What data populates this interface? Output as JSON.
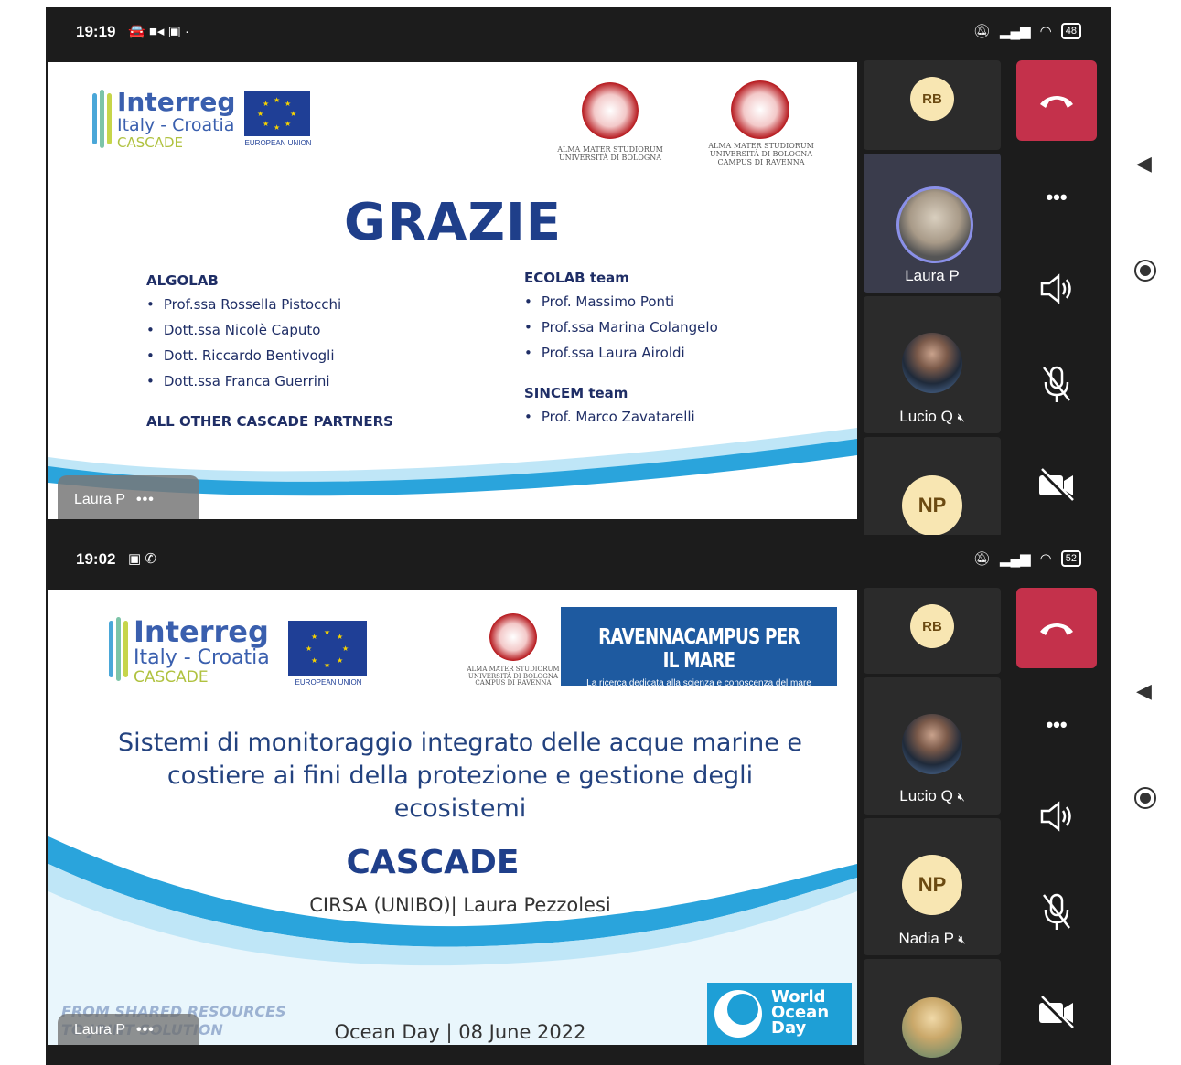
{
  "screens": [
    {
      "status_time": "19:19",
      "status_left_icons": "🚘 ■◂ ▣ ·",
      "battery": "48",
      "slide": {
        "program_name": "Interreg",
        "program_region": "Italy - Croatia",
        "program_project": "CASCADE",
        "eu_caption": "EUROPEAN UNION",
        "seal1_text": "ALMA MATER STUDIORUM\nUNIVERSITÀ DI BOLOGNA",
        "seal2_text": "ALMA MATER STUDIORUM\nUNIVERSITÀ DI BOLOGNA\nCAMPUS DI RAVENNA",
        "title": "GRAZIE",
        "left_col": {
          "heading": "ALGOLAB",
          "items": [
            "Prof.ssa Rossella Pistocchi",
            "Dott.ssa Nicolè Caputo",
            "Dott. Riccardo Bentivogli",
            "Dott.ssa Franca Guerrini"
          ],
          "footer": "ALL OTHER CASCADE PARTNERS"
        },
        "right_col": {
          "heading": "ECOLAB team",
          "items": [
            "Prof. Massimo Ponti",
            "Prof.ssa Marina Colangelo",
            "Prof.ssa Laura Airoldi"
          ],
          "heading2": "SINCEM team",
          "items2": [
            "Prof. Marco Zavatarelli"
          ]
        }
      },
      "presenter_tag": "Laura P",
      "participants": [
        {
          "initials": "RB"
        },
        {
          "name": "Laura P"
        },
        {
          "name": "Lucio Q"
        },
        {
          "initials": "NP"
        }
      ]
    },
    {
      "status_time": "19:02",
      "status_left_icons": "▣ ✆",
      "battery": "52",
      "slide": {
        "program_name": "Interreg",
        "program_region": "Italy - Croatia",
        "program_project": "CASCADE",
        "eu_caption": "EUROPEAN UNION",
        "seal_text": "ALMA MATER STUDIORUM\nUNIVERSITÀ DI BOLOGNA\nCAMPUS DI RAVENNA",
        "ravenna_main": "RAVENNACAMPUS PER IL MARE",
        "ravenna_sub": "La ricerca dedicata alla scienza e conoscenza del mare",
        "talk_title": "Sistemi di monitoraggio integrato delle acque marine e costiere ai fini della protezione e gestione degli ecosistemi",
        "project": "CASCADE",
        "speaker": "CIRSA (UNIBO)| Laura Pezzolesi",
        "date": "Ocean Day | 08 June 2022",
        "watermark_line1": "FROM SHARED RESOURCES",
        "watermark_line2": "TO JOINT SOLUTION",
        "wod_text": "World Ocean Day"
      },
      "presenter_tag": "Laura P",
      "participants": [
        {
          "initials": "RB"
        },
        {
          "name": "Lucio Q"
        },
        {
          "initials": "NP",
          "name": "Nadia P"
        },
        {
          "name": ""
        }
      ]
    }
  ],
  "icons": {
    "mute_badge": "🔇︎",
    "more": "•••",
    "hangup": "phone-hangup-icon",
    "speaker": "speaker-icon",
    "mic_off": "mic-off-icon",
    "camera_off": "camera-off-icon"
  },
  "colors": {
    "hangup": "#c4314b",
    "teams_dark": "#1c1c1c",
    "slide_title": "#1f3f8a"
  }
}
